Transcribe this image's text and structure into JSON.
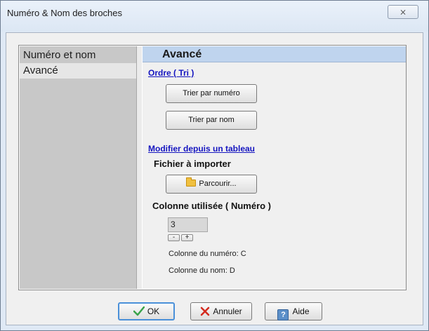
{
  "window": {
    "title": "Numéro & Nom des broches",
    "close_glyph": "⨯"
  },
  "sidebar": {
    "items": [
      {
        "label": "Numéro et nom",
        "selected": false
      },
      {
        "label": "Avancé",
        "selected": true
      }
    ]
  },
  "main": {
    "header": "Avancé",
    "sort_section": {
      "title": "Ordre ( Tri )",
      "sort_by_number": "Trier par numéro",
      "sort_by_name": "Trier par nom"
    },
    "table_section": {
      "title": "Modifier depuis un tableau",
      "file_label": "Fichier à importer",
      "browse": "Parcourir...",
      "column_label": "Colonne utilisée ( Numéro )",
      "column_value": "3",
      "spin_minus": "-",
      "spin_plus": "+",
      "number_column": "Colonne du numéro: C",
      "name_column": "Colonne du nom: D"
    }
  },
  "buttons": {
    "ok": "OK",
    "cancel": "Annuler",
    "help": "Aide",
    "help_glyph": "?"
  },
  "icons": {
    "ok": "check-icon",
    "cancel": "x-icon",
    "help": "help-icon",
    "browse": "folder-icon"
  }
}
